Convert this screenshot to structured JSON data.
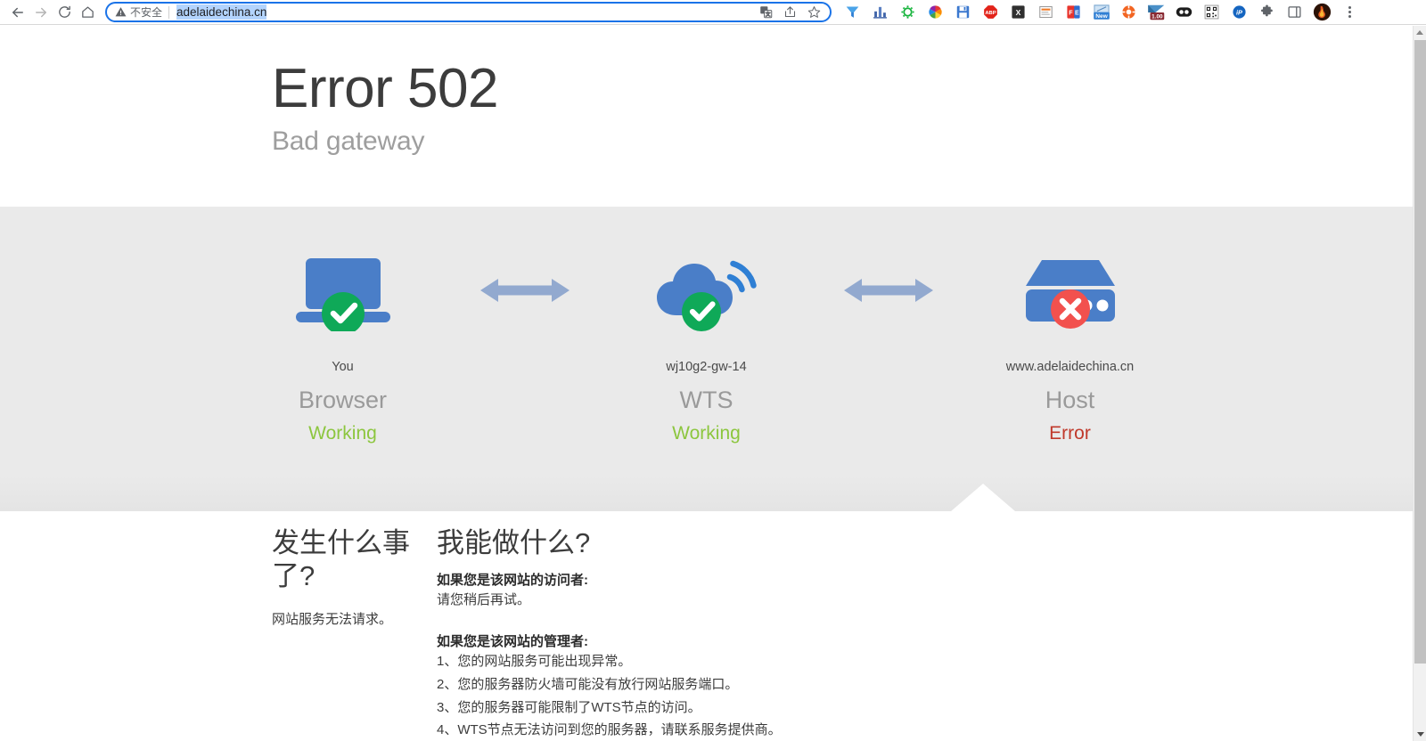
{
  "browser": {
    "nav": {
      "back_title": "Back",
      "forward_title": "Forward",
      "reload_title": "Reload",
      "home_title": "Home"
    },
    "omnibox": {
      "security_label": "不安全",
      "url": "adelaidechina.cn",
      "translate_title": "Translate",
      "share_title": "Share",
      "bookmark_title": "Bookmark"
    },
    "extensions": [
      {
        "name": "funnel-filter-icon",
        "label": ""
      },
      {
        "name": "bar-chart-icon",
        "label": ""
      },
      {
        "name": "green-gear-icon",
        "label": ""
      },
      {
        "name": "color-wheel-icon",
        "label": ""
      },
      {
        "name": "floppy-save-icon",
        "label": ""
      },
      {
        "name": "adblock-plus-icon",
        "label": "ABP"
      },
      {
        "name": "x-black-icon",
        "label": "X"
      },
      {
        "name": "notes-icon",
        "label": ""
      },
      {
        "name": "fe-red-icon",
        "label": "FE"
      },
      {
        "name": "new-tab-badge-icon",
        "label": "New"
      },
      {
        "name": "orange-lifebuoy-icon",
        "label": ""
      },
      {
        "name": "speed-1-00-icon",
        "label": "1.00"
      },
      {
        "name": "two-dots-icon",
        "label": ""
      },
      {
        "name": "qr-code-icon",
        "label": ""
      },
      {
        "name": "ip-blue-icon",
        "label": "iP"
      },
      {
        "name": "puzzle-extensions-icon",
        "label": ""
      },
      {
        "name": "side-panel-icon",
        "label": ""
      },
      {
        "name": "profile-avatar",
        "label": ""
      }
    ],
    "menu_title": "Customize and control"
  },
  "page": {
    "error_code": "Error 502",
    "error_text": "Bad gateway",
    "nodes": [
      {
        "host": "You",
        "kind": "Browser",
        "state": "Working",
        "state_type": "ok",
        "art": "laptop-icon",
        "badge": "check-badge"
      },
      {
        "host": "wj10g2-gw-14",
        "kind": "WTS",
        "state": "Working",
        "state_type": "ok",
        "art": "cloud-wifi-icon",
        "badge": "check-badge"
      },
      {
        "host": "www.adelaidechina.cn",
        "kind": "Host",
        "state": "Error",
        "state_type": "error",
        "art": "server-icon",
        "badge": "cross-badge"
      }
    ],
    "what_happened": {
      "heading": "发生什么事了?",
      "body": "网站服务无法请求。"
    },
    "what_can_i_do": {
      "heading": "我能做什么?",
      "visitor_label": "如果您是该网站的访问者:",
      "visitor_body": "请您稍后再试。",
      "owner_label": "如果您是该网站的管理者:",
      "owner_items": [
        "1、您的网站服务可能出现异常。",
        "2、您的服务器防火墙可能没有放行网站服务端口。",
        "3、您的服务器可能限制了WTS节点的访问。",
        "4、WTS节点无法访问到您的服务器，请联系服务提供商。"
      ]
    }
  },
  "colors": {
    "accent_blue": "#1a73e8",
    "icon_blue": "#4a7ec8",
    "ok_green": "#0fa958",
    "err_red": "#f2514e",
    "working_text": "#8cc63e",
    "error_text": "#c0392b",
    "band_grey": "#eaeaea"
  }
}
